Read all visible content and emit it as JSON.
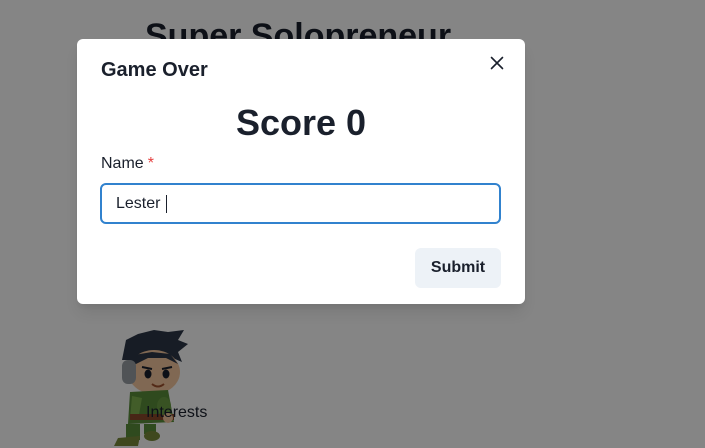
{
  "page": {
    "title": "Super Solopreneur",
    "interests_label": "Interests",
    "character_icon": "character-sprite-icon"
  },
  "modal": {
    "header": "Game Over",
    "score_text": "Score 0",
    "score_value": 0,
    "field_label": "Name",
    "required_mark": "*",
    "name_value": "Lester",
    "submit_label": "Submit",
    "close_icon": "close-icon"
  },
  "colors": {
    "overlay": "#808080",
    "focus_border": "#3182ce",
    "required": "#e53e3e",
    "button_bg": "#edf2f7",
    "text": "#1a202c"
  }
}
